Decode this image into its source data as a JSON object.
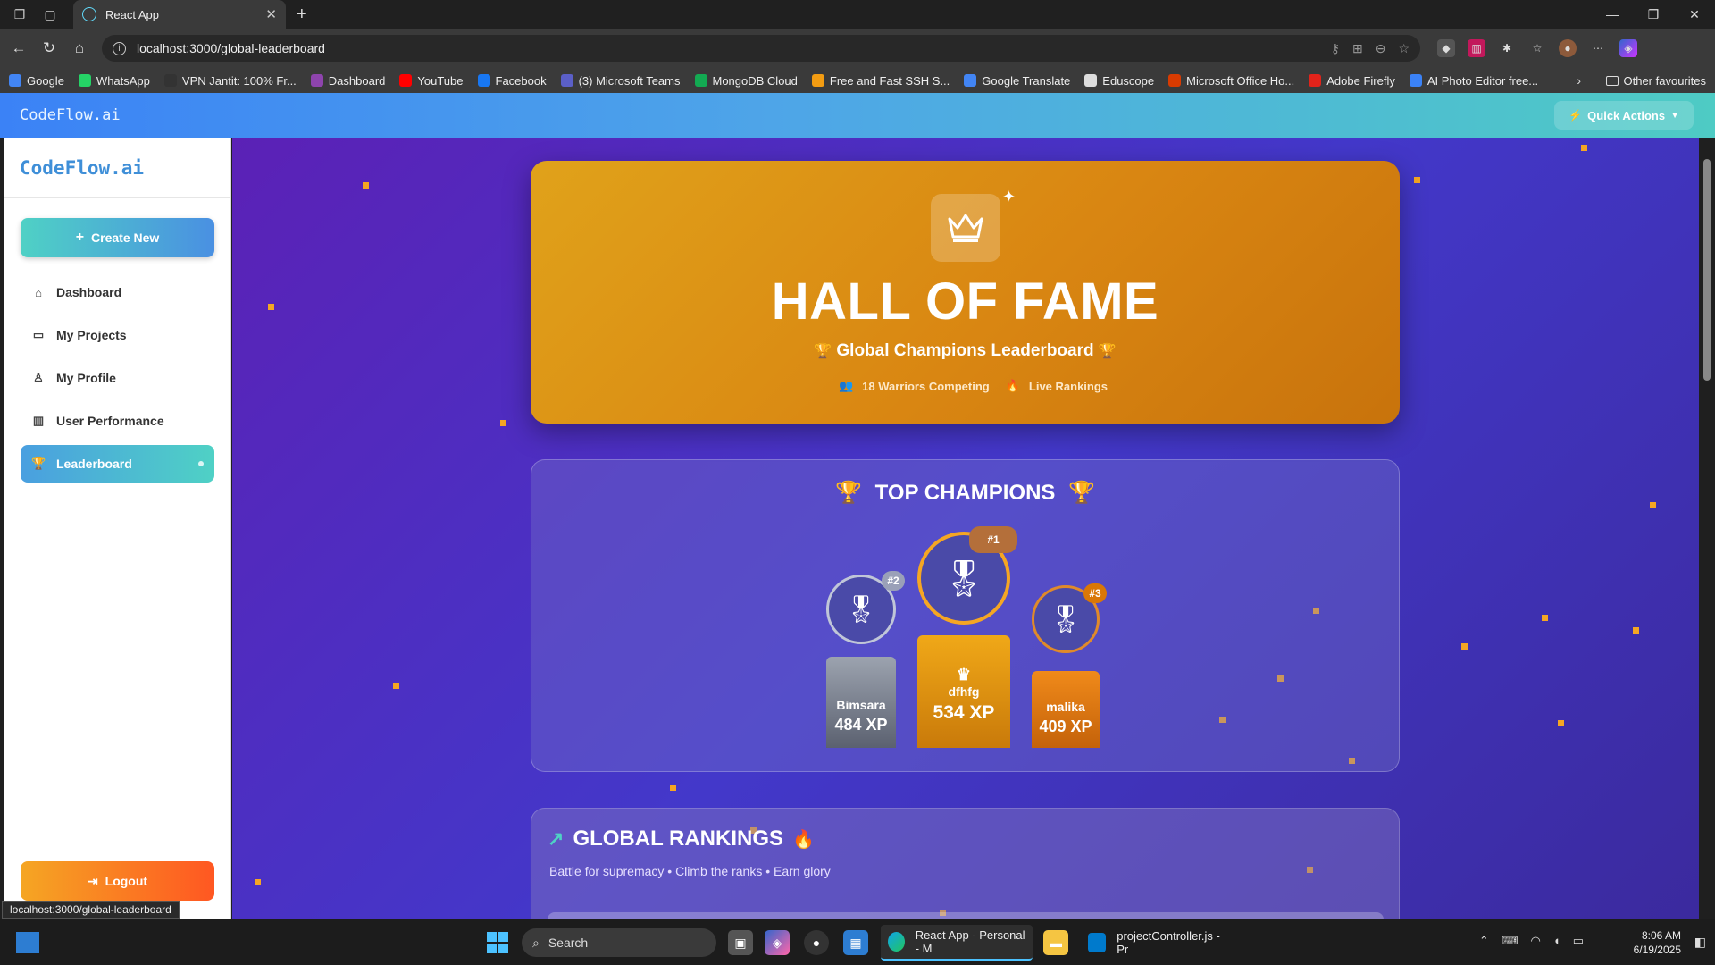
{
  "browser": {
    "tab_title": "React App",
    "url": "localhost:3000/global-leaderboard",
    "bookmarks": [
      {
        "label": "Google",
        "color": "#4285f4"
      },
      {
        "label": "WhatsApp",
        "color": "#25d366"
      },
      {
        "label": "VPN Jantit: 100% Fr...",
        "color": "#333333"
      },
      {
        "label": "Dashboard",
        "color": "#8e44ad"
      },
      {
        "label": "YouTube",
        "color": "#ff0000"
      },
      {
        "label": "Facebook",
        "color": "#1877f2"
      },
      {
        "label": "(3) Microsoft Teams",
        "color": "#5b5fc7"
      },
      {
        "label": "MongoDB Cloud",
        "color": "#13aa52"
      },
      {
        "label": "Free and Fast SSH S...",
        "color": "#f39c12"
      },
      {
        "label": "Google Translate",
        "color": "#4285f4"
      },
      {
        "label": "Eduscope",
        "color": "#dddddd"
      },
      {
        "label": "Microsoft Office Ho...",
        "color": "#d83b01"
      },
      {
        "label": "Adobe Firefly",
        "color": "#e2231a"
      },
      {
        "label": "AI Photo Editor free...",
        "color": "#3b82f6"
      }
    ],
    "other_favourites": "Other favourites",
    "status_url": "localhost:3000/global-leaderboard"
  },
  "app": {
    "brand": "CodeFlow.ai",
    "quick_actions": "Quick Actions",
    "create_new": "Create New",
    "nav": [
      {
        "label": "Dashboard",
        "icon": "home-icon"
      },
      {
        "label": "My Projects",
        "icon": "folder-icon"
      },
      {
        "label": "My Profile",
        "icon": "user-icon"
      },
      {
        "label": "User Performance",
        "icon": "bar-chart-icon"
      },
      {
        "label": "Leaderboard",
        "icon": "trophy-icon"
      }
    ],
    "active_nav": "Leaderboard",
    "logout": "Logout"
  },
  "hero": {
    "title": "HALL OF FAME",
    "subtitle": "Global Champions Leaderboard",
    "warriors": "18 Warriors Competing",
    "live": "Live Rankings"
  },
  "champions": {
    "title": "TOP CHAMPIONS",
    "podium": [
      {
        "rank": "#2",
        "name": "Bimsara",
        "xp": "484 XP"
      },
      {
        "rank": "#1",
        "name": "dfhfg",
        "xp": "534 XP"
      },
      {
        "rank": "#3",
        "name": "malika",
        "xp": "409 XP"
      }
    ]
  },
  "rankings": {
    "title": "GLOBAL RANKINGS",
    "subtitle": "Battle for supremacy • Climb the ranks • Earn glory"
  },
  "taskbar": {
    "search": "Search",
    "apps": [
      {
        "label": "React App - Personal - M"
      },
      {
        "label": "projectController.js - Pr"
      }
    ],
    "time": "8:06 AM",
    "date": "6/19/2025"
  },
  "colors": {
    "accent_gold": "#e0a21a",
    "accent_teal": "#4fd1c5",
    "background_purple": "#4338ca"
  }
}
